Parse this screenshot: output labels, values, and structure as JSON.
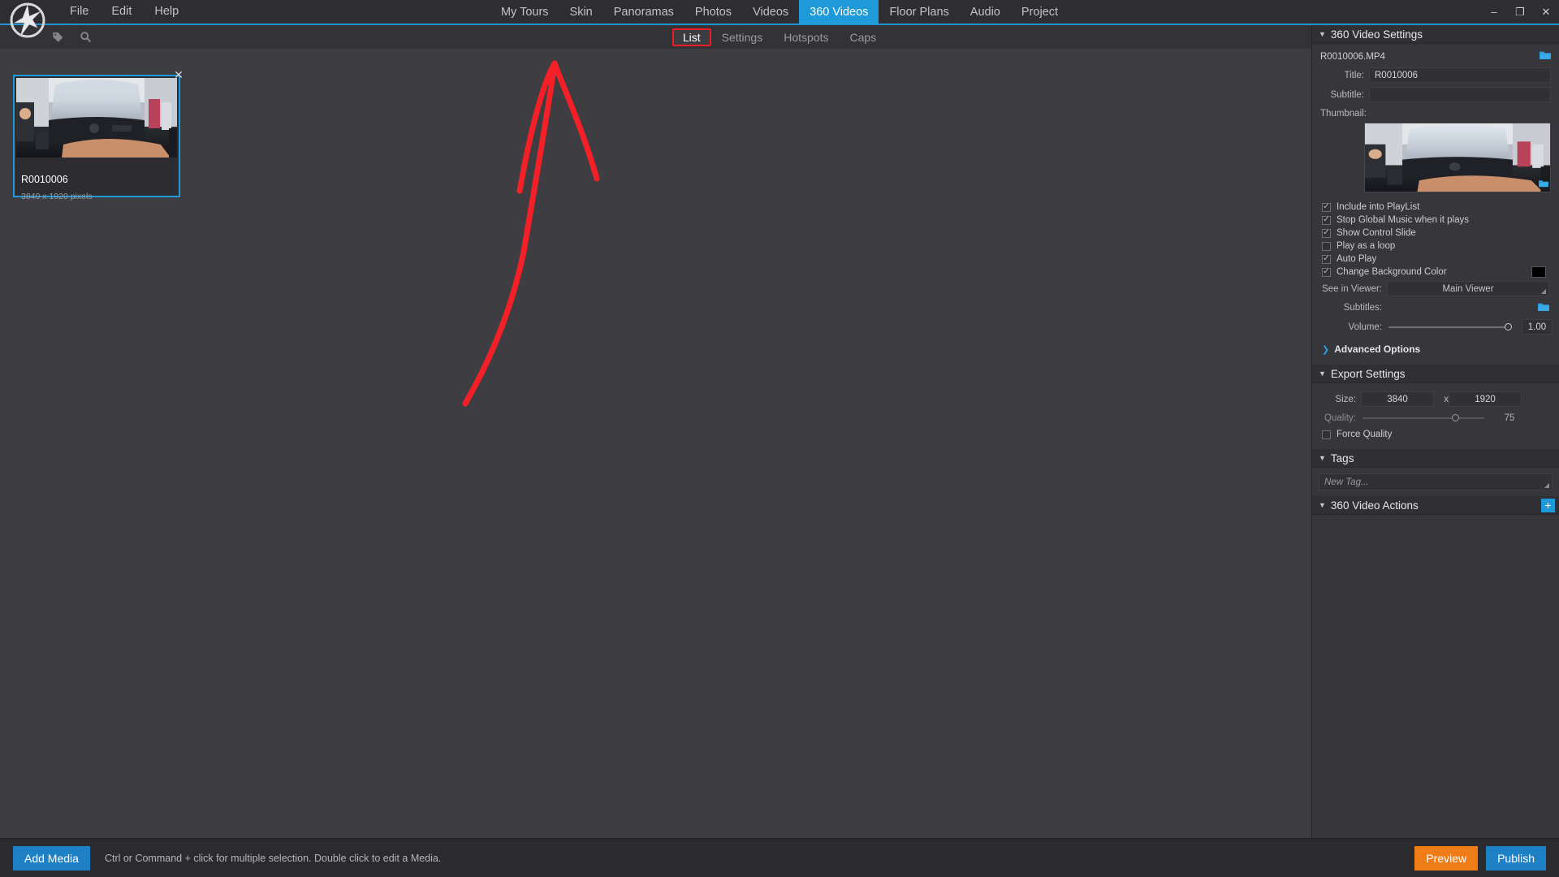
{
  "app": {
    "menu": [
      "File",
      "Edit",
      "Help"
    ],
    "nav_tabs": [
      {
        "label": "My Tours",
        "active": false
      },
      {
        "label": "Skin",
        "active": false
      },
      {
        "label": "Panoramas",
        "active": false
      },
      {
        "label": "Photos",
        "active": false
      },
      {
        "label": "Videos",
        "active": false
      },
      {
        "label": "360 Videos",
        "active": true
      },
      {
        "label": "Floor Plans",
        "active": false
      },
      {
        "label": "Audio",
        "active": false
      },
      {
        "label": "Project",
        "active": false
      }
    ],
    "window_controls": {
      "minimize": "–",
      "maximize": "❐",
      "close": "✕"
    }
  },
  "subbar": {
    "icons": [
      {
        "name": "tag-icon",
        "glyph": "🏷"
      },
      {
        "name": "search-icon",
        "glyph": "🔍"
      }
    ],
    "tabs": [
      {
        "label": "List",
        "active": true
      },
      {
        "label": "Settings",
        "active": false
      },
      {
        "label": "Hotspots",
        "active": false
      },
      {
        "label": "Caps",
        "active": false
      }
    ]
  },
  "media_list": [
    {
      "title": "R0010006",
      "dimensions": "3840 x 1920 pixels",
      "selected": true,
      "close_glyph": "✕"
    }
  ],
  "right_panel": {
    "video_settings": {
      "header": "360 Video Settings",
      "caret": "▼",
      "filename": "R0010006.MP4",
      "title_label": "Title:",
      "title_value": "R0010006",
      "subtitle_label": "Subtitle:",
      "subtitle_value": "",
      "thumbnail_label": "Thumbnail:",
      "checkboxes": [
        {
          "label": "Include into PlayList",
          "checked": true
        },
        {
          "label": "Stop Global Music when it plays",
          "checked": true
        },
        {
          "label": "Show Control Slide",
          "checked": true
        },
        {
          "label": "Play as a loop",
          "checked": false
        },
        {
          "label": "Auto Play",
          "checked": true
        },
        {
          "label": "Change Background Color",
          "checked": true,
          "swatch": "#000000"
        }
      ],
      "see_in_viewer_label": "See in Viewer:",
      "see_in_viewer_value": "Main Viewer",
      "subtitles_label": "Subtitles:",
      "volume_label": "Volume:",
      "volume_value": "1.00",
      "volume_percent": 100,
      "advanced_options": "Advanced Options",
      "advanced_caret": "❯"
    },
    "export_settings": {
      "header": "Export Settings",
      "caret": "▼",
      "size_label": "Size:",
      "size_width": "3840",
      "size_x": "x",
      "size_height": "1920",
      "quality_label": "Quality:",
      "quality_value": "75",
      "quality_percent": 75,
      "force_quality_label": "Force Quality",
      "force_quality_checked": false
    },
    "tags": {
      "header": "Tags",
      "caret": "▼",
      "new_tag_placeholder": "New Tag..."
    },
    "actions": {
      "header": "360 Video Actions",
      "caret": "▼",
      "add_glyph": "+"
    }
  },
  "bottom_bar": {
    "add_media_label": "Add Media",
    "status_text": "Ctrl or Command + click for multiple selection. Double click to edit a Media.",
    "preview_label": "Preview",
    "publish_label": "Publish"
  },
  "colors": {
    "accent_blue": "#1e9ada",
    "annotation_red": "#f32028",
    "orange": "#ef7d17",
    "panel_bg": "#36363b"
  }
}
